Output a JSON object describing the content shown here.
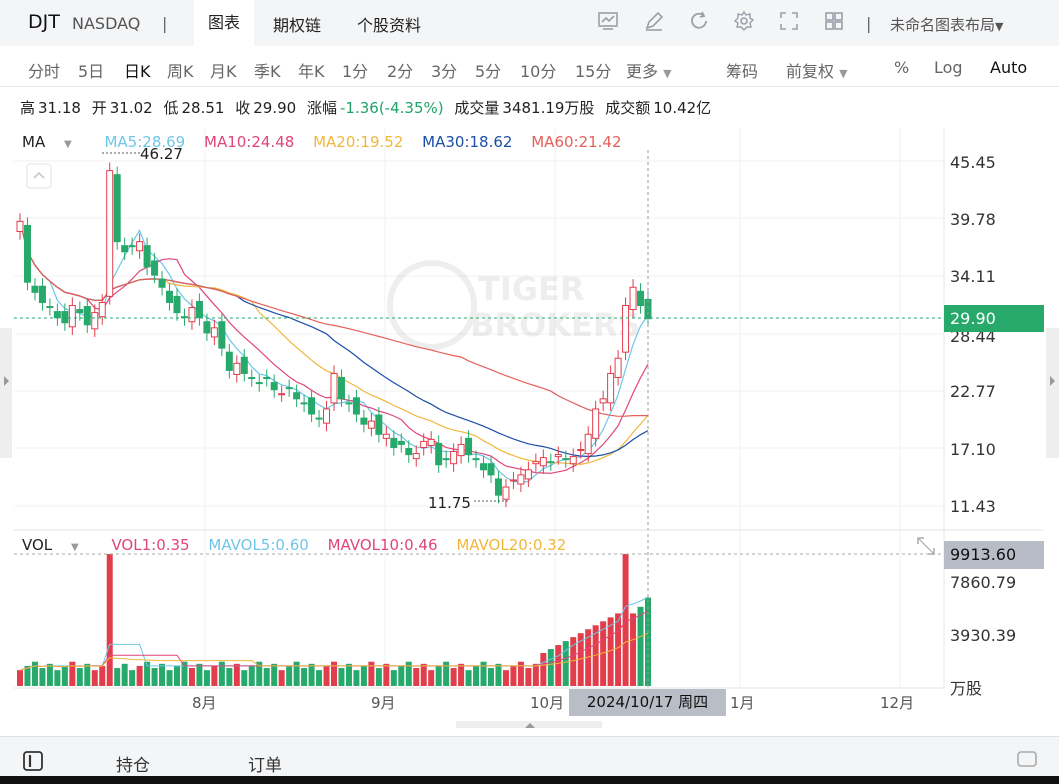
{
  "header": {
    "ticker": "DJT",
    "exchange": "NASDAQ",
    "separator": "|",
    "tabs": [
      "图表",
      "期权链",
      "个股资料"
    ],
    "active_tab": "图表",
    "layout_label": "未命名图表布局",
    "tools": [
      "chart-compare-icon",
      "draw-pen-icon",
      "refresh-icon",
      "settings-gear-icon",
      "fullscreen-icon",
      "layout-grid-icon"
    ]
  },
  "periods": {
    "items": [
      "分时",
      "5日",
      "日K",
      "周K",
      "月K",
      "季K",
      "年K",
      "1分",
      "2分",
      "3分",
      "5分",
      "10分",
      "15分",
      "更多"
    ],
    "active": "日K",
    "right_items": [
      "筹码",
      "前复权",
      "%",
      "Log",
      "Auto"
    ]
  },
  "quote": {
    "high_label": "高",
    "high": "31.18",
    "open_label": "开",
    "open": "31.02",
    "low_label": "低",
    "low": "28.51",
    "close_label": "收",
    "close": "29.90",
    "change_label": "涨幅",
    "change": "-1.36(-4.35%)",
    "volume_label": "成交量",
    "volume": "3481.19万股",
    "amount_label": "成交额",
    "amount": "10.42亿"
  },
  "ma_legend": {
    "name": "MA",
    "items": [
      {
        "label": "MA5:28.69",
        "color": "#6ec6e8"
      },
      {
        "label": "MA10:24.48",
        "color": "#e0457b"
      },
      {
        "label": "MA20:19.52",
        "color": "#f0b73c"
      },
      {
        "label": "MA30:18.62",
        "color": "#1b4fa8"
      },
      {
        "label": "MA60:21.42",
        "color": "#e6605a"
      }
    ]
  },
  "vol_legend": {
    "name": "VOL",
    "items": [
      {
        "label": "VOL1:0.35",
        "color": "#e0457b"
      },
      {
        "label": "MAVOL5:0.60",
        "color": "#6ec6e8"
      },
      {
        "label": "MAVOL10:0.46",
        "color": "#e0457b"
      },
      {
        "label": "MAVOL20:0.32",
        "color": "#f0b73c"
      }
    ]
  },
  "price_axis": [
    "45.45",
    "39.78",
    "34.11",
    "28.44",
    "22.77",
    "17.10",
    "11.43"
  ],
  "current_price": "29.90",
  "vol_axis": [
    "7860.79",
    "3930.39"
  ],
  "vol_unit": "万股",
  "current_vol": "9913.60",
  "time_axis": [
    "8月",
    "9月",
    "10月",
    "1月",
    "12月"
  ],
  "crosshair_date": "2024/10/17 周四",
  "annotations": {
    "high": "46.27",
    "low": "11.75"
  },
  "colors": {
    "up": "#e23d4b",
    "down": "#26a96b",
    "accent": "#1b4fa8"
  },
  "bottom_tabs": [
    "持仓",
    "订单"
  ],
  "chart_data": {
    "type": "candlestick",
    "series_close": [
      39.5,
      33.5,
      32.5,
      31.5,
      31.0,
      30.0,
      29.5,
      31.2,
      30.5,
      29.3,
      30.5,
      31.5,
      44.5,
      37.5,
      36.5,
      37.0,
      37.5,
      35.0,
      34.2,
      33.0,
      31.5,
      30.5,
      30.0,
      31.0,
      30.0,
      28.5,
      29.0,
      27.0,
      24.8,
      25.5,
      24.5,
      24.0,
      23.5,
      24.0,
      22.9,
      22.5,
      23.0,
      22.0,
      21.5,
      20.5,
      20.0,
      21.0,
      24.5,
      22.0,
      21.5,
      20.5,
      19.5,
      19.8,
      18.5,
      18.5,
      17.2,
      17.5,
      16.5,
      16.6,
      17.8,
      18.0,
      15.5,
      16.0,
      16.8,
      17.5,
      16.5,
      16.0,
      15.0,
      14.5,
      12.5,
      13.3,
      14.0,
      14.5,
      15.0,
      15.8,
      16.2,
      15.7,
      16.5,
      16.0,
      16.3,
      17.0,
      18.5,
      21.0,
      22.0,
      24.5,
      26.0,
      31.2,
      33.0,
      31.2,
      29.9
    ],
    "ylim": [
      11.43,
      45.45
    ]
  }
}
